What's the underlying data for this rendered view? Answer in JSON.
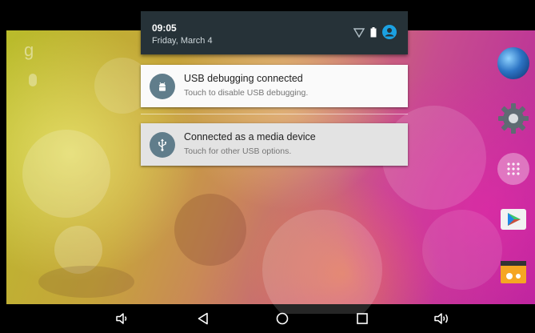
{
  "status": {
    "time": "09:05",
    "date": "Friday, March 4"
  },
  "notifications": [
    {
      "title": "USB debugging connected",
      "subtitle": "Touch to disable USB debugging.",
      "icon": "android-icon"
    },
    {
      "title": "Connected as a media device",
      "subtitle": "Touch for other USB options.",
      "icon": "usb-icon"
    }
  ],
  "launcher": {
    "search_letter": "g",
    "dock": [
      "globe-icon",
      "settings-gear-icon",
      "app-drawer-icon",
      "play-store-icon",
      "movie-studio-icon"
    ]
  },
  "navigation": [
    "volume-down-icon",
    "back-icon",
    "home-icon",
    "recents-icon",
    "volume-up-icon"
  ],
  "colors": {
    "shade_header": "#263238",
    "notification_icon_bg": "#607d8b",
    "account_icon": "#1ba1e2"
  }
}
